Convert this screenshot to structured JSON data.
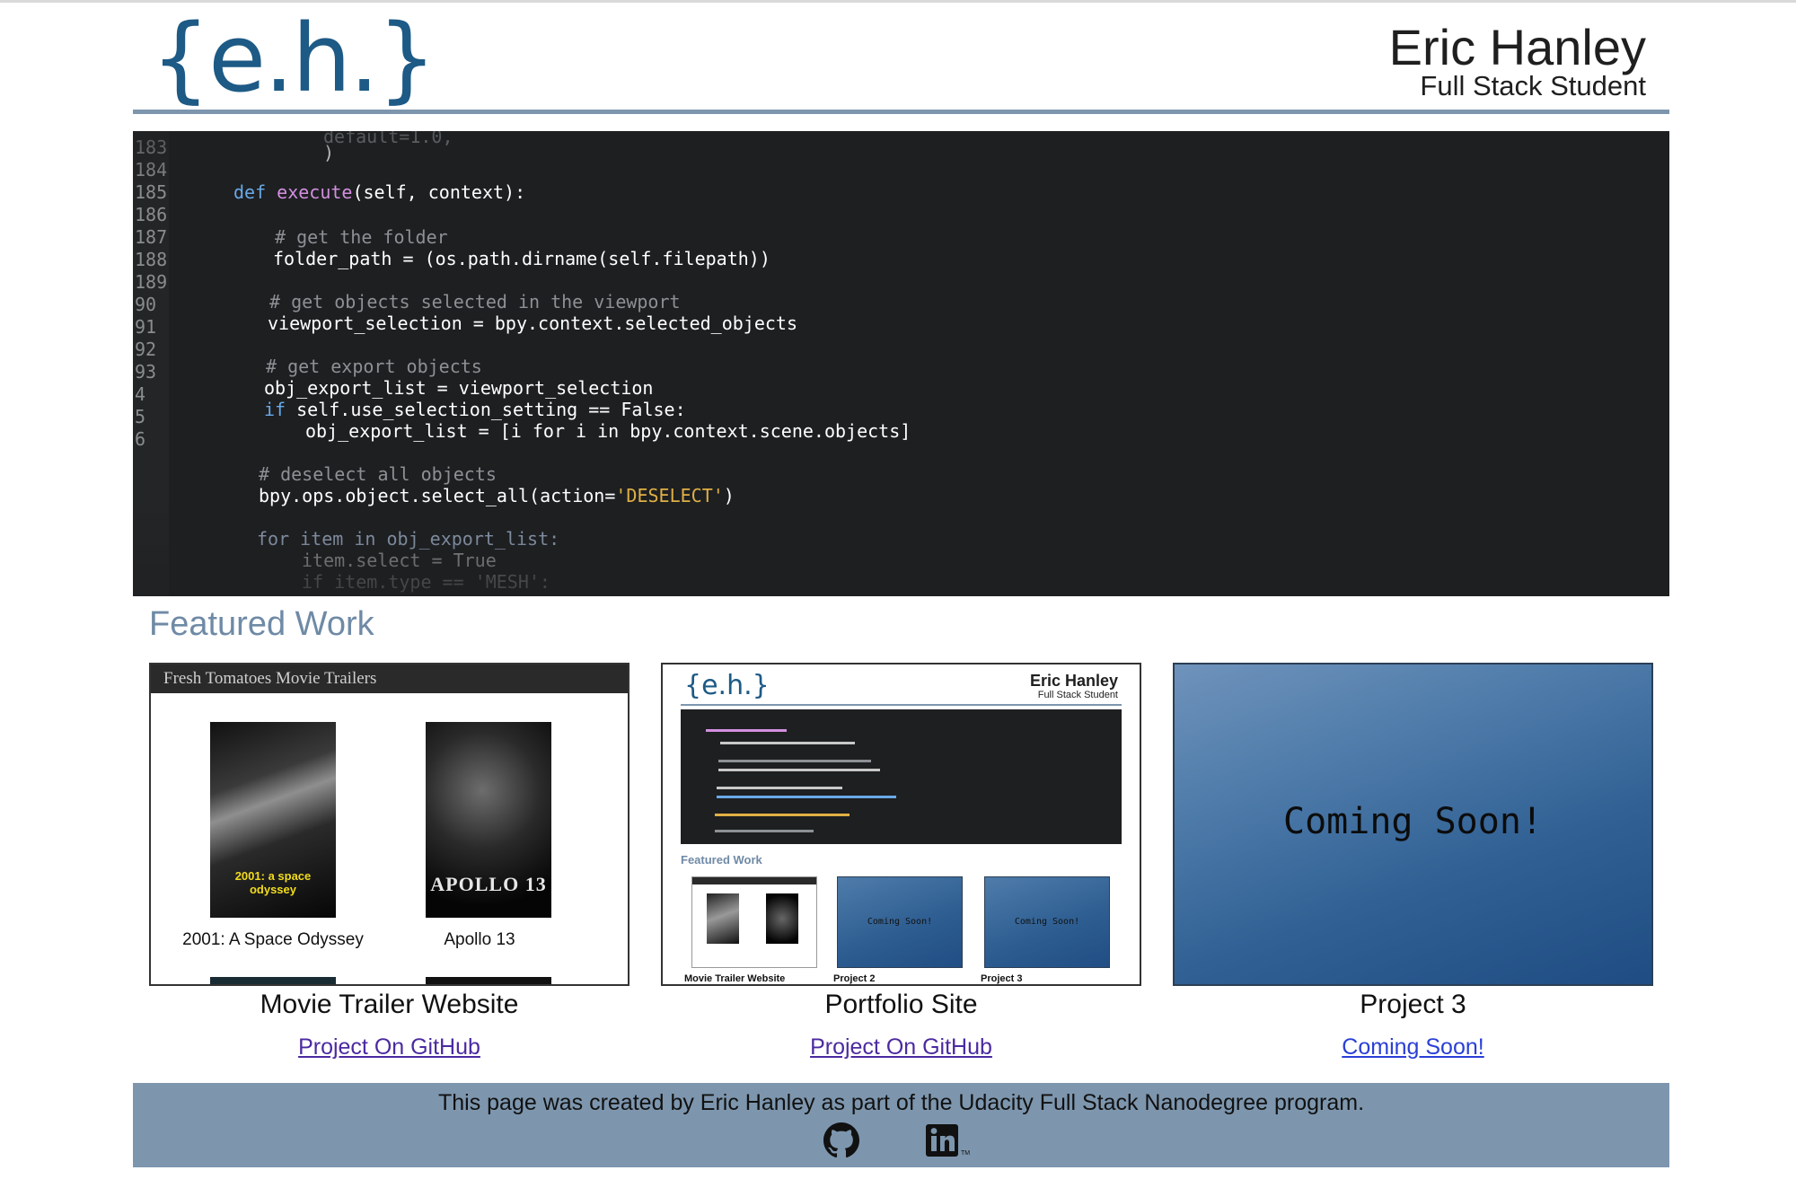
{
  "header": {
    "logo": "{e.h.}",
    "name": "Eric Hanley",
    "subtitle": "Full Stack Student"
  },
  "hero": {
    "line_numbers": [
      "183",
      "184",
      "185",
      "186",
      "187",
      "188",
      "189",
      "90",
      "91",
      "92",
      "93",
      "4",
      "5",
      "6"
    ],
    "code": {
      "l1": "default=1.0,",
      "l2": ")",
      "l3_kw": "def",
      "l3_fn": "execute",
      "l3_rest": "(self, context):",
      "l4": "# get the folder",
      "l5": "folder_path = (os.path.dirname(self.filepath))",
      "l6": "# get objects selected in the viewport",
      "l7": "viewport_selection = bpy.context.selected_objects",
      "l8": "# get export objects",
      "l9": "obj_export_list = viewport_selection",
      "l10_kw": "if",
      "l10_rest": "self.use_selection_setting == False:",
      "l11": "obj_export_list = [i for i in bpy.context.scene.objects]",
      "l12": "# deselect all objects",
      "l13_a": "bpy.ops.object.select_all(action=",
      "l13_str": "'DESELECT'",
      "l13_b": ")",
      "l14": "for item in obj_export_list:",
      "l15": "item.select = True",
      "l16": "if item.type == 'MESH':"
    }
  },
  "featured": {
    "title": "Featured Work",
    "cards": [
      {
        "title": "Movie Trailer Website",
        "link": "Project On GitHub",
        "preview": {
          "bar": "Fresh Tomatoes Movie Trailers",
          "movies": [
            {
              "title": "2001: A Space Odyssey",
              "poster_text": "2001: a space odyssey"
            },
            {
              "title": "Apollo 13",
              "poster_text": "APOLLO 13"
            }
          ]
        }
      },
      {
        "title": "Portfolio Site",
        "link": "Project On GitHub",
        "preview": {
          "logo": "{e.h.}",
          "name": "Eric Hanley",
          "subtitle": "Full Stack Student",
          "featured": "Featured Work",
          "coming": "Coming Soon!",
          "labels": [
            "Movie Trailer Website",
            "Project 2",
            "Project 3"
          ]
        }
      },
      {
        "title": "Project 3",
        "link": "Coming Soon!",
        "preview": {
          "text": "Coming Soon!"
        }
      }
    ]
  },
  "footer": {
    "text": "This page was created by Eric Hanley as part of the Udacity Full Stack Nanodegree program.",
    "icons": [
      "github-icon",
      "linkedin-icon"
    ]
  },
  "colors": {
    "brand_blue": "#1d5a85",
    "accent_steel": "#7d96ae",
    "section_title": "#6f8aa6",
    "link_visited": "#4b2aa0",
    "link": "#2a3fd6"
  }
}
